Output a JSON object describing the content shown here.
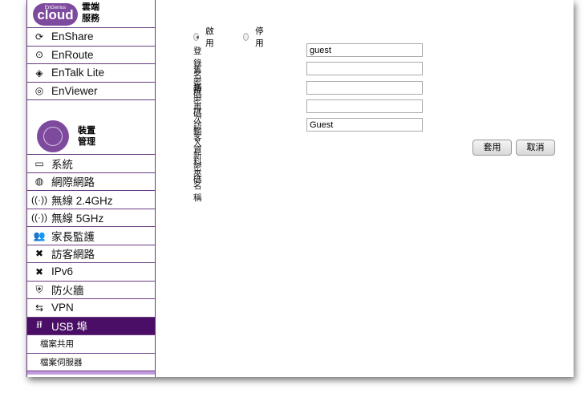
{
  "sidebar": {
    "cloud": {
      "logo": "cloud",
      "logo_small": "EnGenius",
      "title": "雲端服務"
    },
    "cloud_items": [
      {
        "label": "EnShare",
        "icon": "sync-icon"
      },
      {
        "label": "EnRoute",
        "icon": "location-pin-icon"
      },
      {
        "label": "EnTalk Lite",
        "icon": "talk-icon"
      },
      {
        "label": "EnViewer",
        "icon": "camera-icon"
      }
    ],
    "device": {
      "title": "裝置管理"
    },
    "items": [
      {
        "label": "系統",
        "icon": "monitor-icon"
      },
      {
        "label": "網際網路",
        "icon": "globe-icon"
      },
      {
        "label": "無線 2.4GHz",
        "icon": "wireless-icon"
      },
      {
        "label": "無線 5GHz",
        "icon": "wireless-icon"
      },
      {
        "label": "家長監護",
        "icon": "users-icon"
      },
      {
        "label": "訪客網路",
        "icon": "tools-icon"
      },
      {
        "label": "IPv6",
        "icon": "tools-icon"
      },
      {
        "label": "防火牆",
        "icon": "shield-icon"
      },
      {
        "label": "VPN",
        "icon": "arrows-icon"
      },
      {
        "label": "USB 埠",
        "icon": "usb-icon"
      }
    ],
    "sub_items": [
      "檔案共用",
      "檔案伺服器"
    ]
  },
  "form": {
    "enable": "啟用",
    "disable": "停用",
    "selected": "enable",
    "fields": [
      {
        "label": "登錄名稱",
        "value": "guest"
      },
      {
        "label": "舊密碼",
        "value": ""
      },
      {
        "label": "新密碼",
        "value": ""
      },
      {
        "label": "再次輸入新密碼",
        "value": ""
      },
      {
        "label": "訪客資料夾名稱",
        "value": "Guest"
      }
    ],
    "apply": "套用",
    "cancel": "取消"
  },
  "colors": {
    "accent": "#4a0e66",
    "brand": "#7e4a9e"
  }
}
